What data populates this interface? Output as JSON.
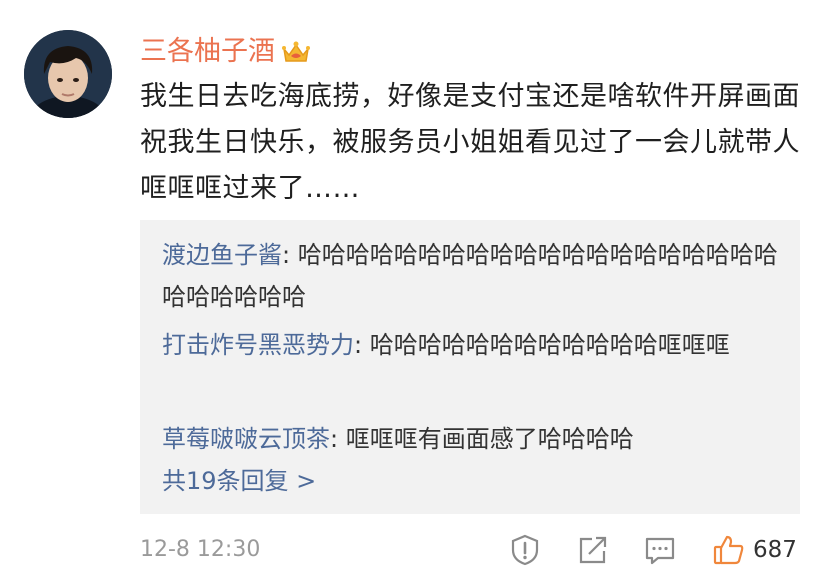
{
  "comment": {
    "username": "三各柚子酒",
    "text": "我生日去吃海底捞，好像是支付宝还是啥软件开屏画面祝我生日快乐，被服务员小姐姐看见过了一会儿就带人哐哐哐过来了……",
    "time": "12-8 12:30",
    "like_count": "687"
  },
  "replies": [
    {
      "name": "渡边鱼子酱",
      "separator": ": ",
      "text": "哈哈哈哈哈哈哈哈哈哈哈哈哈哈哈哈哈哈哈哈哈哈哈哈哈哈"
    },
    {
      "name": "打击炸号黑恶势力",
      "separator": ": ",
      "text": "哈哈哈哈哈哈哈哈哈哈哈哈哐哐哐"
    },
    {
      "name": "草莓啵啵云顶茶",
      "separator": ": ",
      "text": "哐哐哐有画面感了哈哈哈哈"
    }
  ],
  "more_replies": "共19条回复 >",
  "icons": {
    "badge": "crown-badge-icon",
    "report": "report-icon",
    "share": "share-icon",
    "comment": "comment-icon",
    "like": "thumbs-up-icon"
  },
  "colors": {
    "username": "#eb7350",
    "reply_name": "#4d6a99",
    "like": "#f0873c"
  }
}
